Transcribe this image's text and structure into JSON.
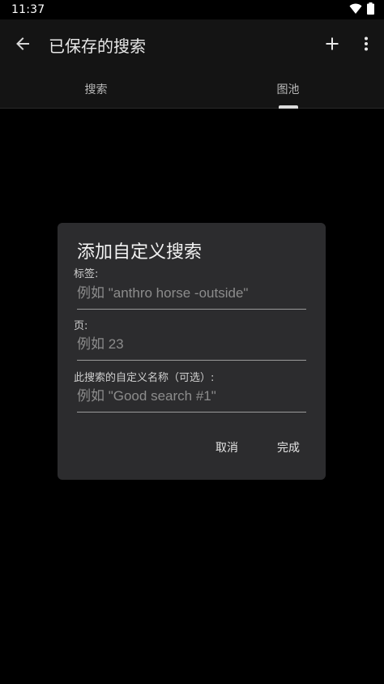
{
  "status_bar": {
    "time": "11:37",
    "icons": [
      "wifi-icon",
      "battery-icon"
    ]
  },
  "app_bar": {
    "title": "已保存的搜索",
    "back_icon": "arrow-left-icon",
    "add_icon": "plus-icon",
    "more_icon": "more-vert-icon"
  },
  "tabs": [
    {
      "label": "搜索",
      "selected": false
    },
    {
      "label": "图池",
      "selected": true
    }
  ],
  "dialog": {
    "title": "添加自定义搜索",
    "fields": [
      {
        "label": "标签:",
        "value": "",
        "placeholder": "例如 \"anthro horse -outside\""
      },
      {
        "label": "页:",
        "value": "",
        "placeholder": "例如 23"
      },
      {
        "label": "此搜索的自定义名称（可选）:",
        "value": "",
        "placeholder": "例如 \"Good search #1\""
      }
    ],
    "cancel_label": "取消",
    "done_label": "完成"
  },
  "colors": {
    "background": "#000000",
    "app_bar": "#141414",
    "dialog": "#2c2c2e",
    "text": "#ffffff"
  }
}
